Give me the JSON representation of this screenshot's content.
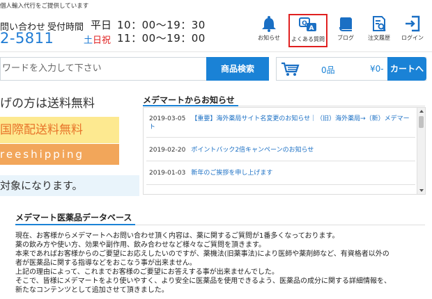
{
  "header": {
    "top_note": "個人輸入代行をご提供しています",
    "contact_label": "問い合わせ",
    "hours_label": "受付時間",
    "phone": "2-5811",
    "weekday_label": "平日",
    "weekday_hours": "10：00〜19：30",
    "holiday_sat": "土",
    "holiday_rest": "日祝",
    "holiday_hours": "11：00〜19：00"
  },
  "nav": {
    "items": [
      {
        "label": "お知らせ",
        "icon": "bell-icon"
      },
      {
        "label": "よくある質問",
        "icon": "faq-icon"
      },
      {
        "label": "ブログ",
        "icon": "book-icon"
      },
      {
        "label": "注文履歴",
        "icon": "order-history-icon"
      },
      {
        "label": "ログイン",
        "icon": "login-icon"
      }
    ],
    "highlight_color": "#e02020"
  },
  "search": {
    "placeholder": "ワードを入力して下さい",
    "button_label": "商品検索"
  },
  "cart": {
    "count": "0品",
    "total": "¥0-",
    "button_label": "カートへ"
  },
  "banner": {
    "line1": "げの方は送料無料",
    "line2": "国際配送料無料",
    "line3": "reeshipping",
    "line4": "対象になります。"
  },
  "news": {
    "title": "メデマートからお知らせ",
    "items": [
      {
        "date": "2019-03-05",
        "text": "【重要】海外薬局サイト名変更のお知らせ｜（旧）海外薬局→（新）メデマー",
        "text2": "ト"
      },
      {
        "date": "2019-02-20",
        "text": "ポイントバック2倍キャンペーンのお知らせ"
      },
      {
        "date": "2019-01-03",
        "text": "新年のご挨拶を申し上げます"
      }
    ]
  },
  "database": {
    "title": "メデマート医薬品データベース",
    "paragraphs": [
      "現在、お客様からメデマートへお問い合わせ頂く内容は、薬に関するご質問が1番多くなっております。",
      "薬の飲み方や使い方、効果や副作用、飲み合わせなど様々なご質問を頂きます。",
      "本来であればお客様からのご要望にお応えしたいのですが、薬機法(旧薬事法)により医師や薬剤師など、有資格者以外の",
      "者が医薬品に関する指導などをおこなう事が出来ません。",
      "上記の理由によって、これまでお客様のご要望にお答えする事が出来ませんでした。",
      "そこで、皆様にメデマートをより使いやすく、より安全に医薬品を使用できるよう、医薬品の成分に関する詳細情報を、",
      "新たなコンテンツとして追加させて頂きました。"
    ]
  },
  "colors": {
    "accent": "#1a82d6",
    "banner_yellow": "#fde990",
    "banner_orange": "#f2a65a",
    "link": "#1a6fc4"
  }
}
